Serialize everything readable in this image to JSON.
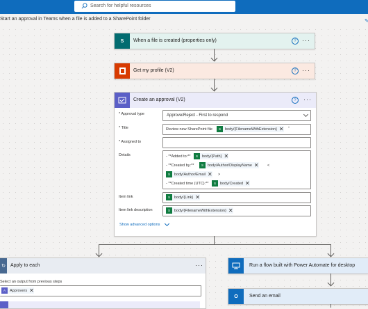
{
  "search": {
    "placeholder": "Search for helpful resources"
  },
  "flow_title": "Start an approval in Teams when a file is added to a SharePoint folder",
  "trigger": {
    "title": "When a file is created (properties only)",
    "help": "?",
    "more": "···"
  },
  "profile": {
    "title": "Get my profile (V2)",
    "help": "?",
    "more": "···"
  },
  "approval": {
    "title": "Create an approval (V2)",
    "help": "?",
    "more": "···",
    "approval_type_label": "* Approval type",
    "approval_type_value": "Approve/Reject - First to respond",
    "title_label": "* Title",
    "title_prefix": "Review new SharePoint file",
    "title_token": "body/{FilenameWithExtension}",
    "title_suffix": "\"",
    "assigned_label": "* Assigned to",
    "details_label": "Details",
    "details": {
      "l1_text": "- **Added to:**",
      "l1_token": "body/{Path}",
      "l2_text": "- **Created by:**",
      "l2_token": "body/Author/DisplayName",
      "l2_suffix": "<",
      "l3_token": "body/Author/Email",
      "l3_suffix": ">",
      "l4_text": "- **Created time (UTC):**",
      "l4_token": "body/Created"
    },
    "item_link_label": "Item link",
    "item_link_token": "body/{Link}",
    "item_link_desc_label": "Item link description",
    "item_link_desc_token": "body/{FilenameWithExtension}",
    "advanced": "Show advanced options"
  },
  "apply_each": {
    "title": "Apply to each",
    "more": "···",
    "select_label": "Select an output from previous steps",
    "token": "Approvers"
  },
  "desktop_flow": {
    "title": "Run a flow built with Power Automate for desktop"
  },
  "send_email": {
    "title": "Send an email"
  },
  "colors": {
    "accent": "#0f6cbd",
    "sharepoint": "#036c70",
    "office": "#d83b01",
    "approvals": "#5b5fc7"
  }
}
